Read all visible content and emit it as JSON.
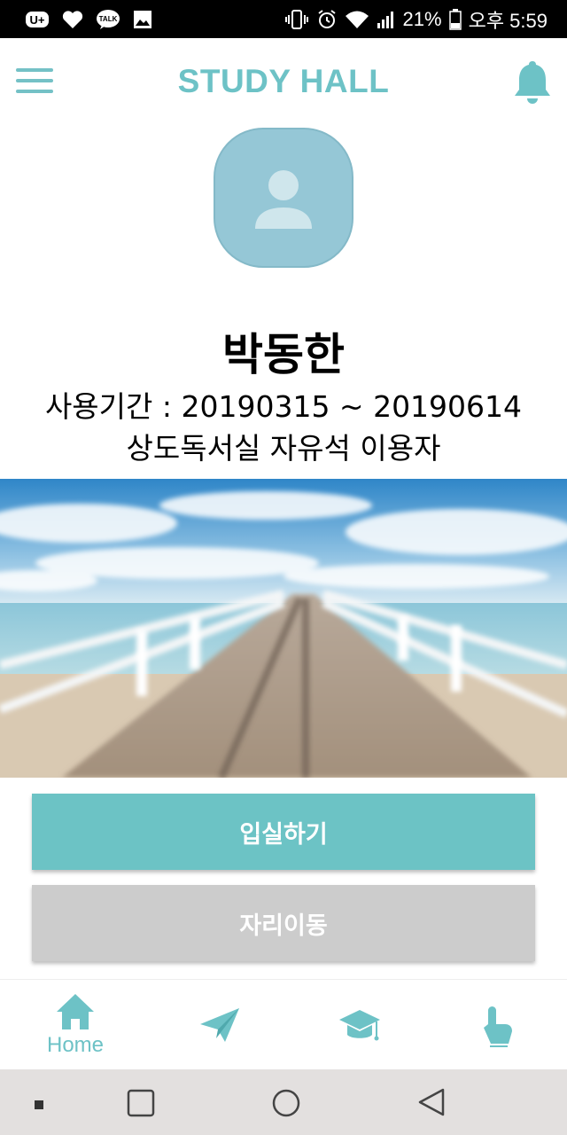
{
  "status_bar": {
    "battery_percent": "21%",
    "time": "오후 5:59",
    "left_icons": [
      "u-plus-icon",
      "heart-icon",
      "kakao-talk-icon",
      "image-icon"
    ],
    "talk_label": "TALK"
  },
  "app_bar": {
    "title": "STUDY HALL"
  },
  "profile": {
    "name": "박동한",
    "period": "사용기간 : 20190315 ~ 20190614",
    "user_type": "상도독서실 자유석 이용자"
  },
  "actions": {
    "enter_label": "입실하기",
    "move_seat_label": "자리이동"
  },
  "bottom_nav": {
    "home_label": "Home",
    "items": [
      "home-icon",
      "paper-plane-icon",
      "graduation-cap-icon",
      "touch-icon"
    ]
  },
  "colors": {
    "accent": "#6cc3c5",
    "disabled": "#cccccc",
    "avatar_bg": "#95c7d6"
  }
}
